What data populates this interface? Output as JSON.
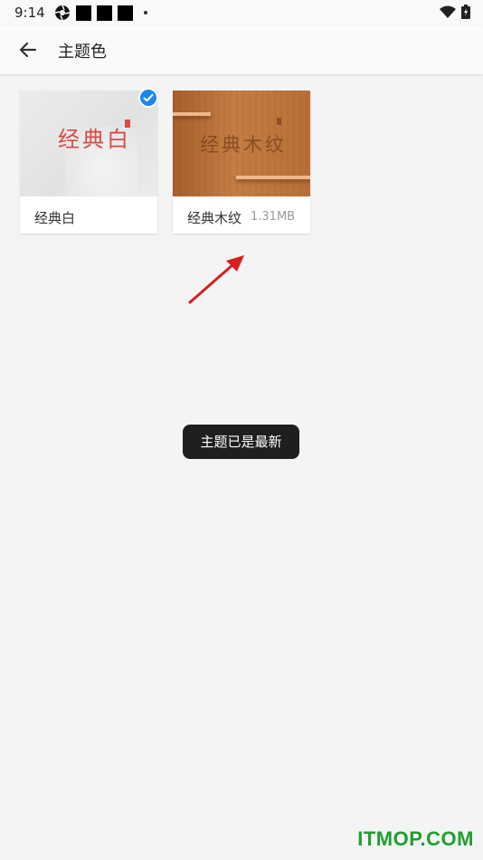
{
  "status_bar": {
    "time": "9:14"
  },
  "app_bar": {
    "title": "主题色",
    "back_icon": "arrow-left-icon"
  },
  "themes": [
    {
      "thumb_text": "经典白",
      "label": "经典白",
      "size": "",
      "selected": true
    },
    {
      "thumb_text": "经典木纹",
      "label": "经典木纹",
      "size": "1.31MB",
      "selected": false
    }
  ],
  "toast": {
    "text": "主题已是最新"
  },
  "watermark": {
    "text": "ITMOP.COM"
  },
  "colors": {
    "accent": "#1b86f3",
    "classic_red": "#d64b46",
    "wood": "#b86f37",
    "watermark_green": "#1f9f2f"
  }
}
